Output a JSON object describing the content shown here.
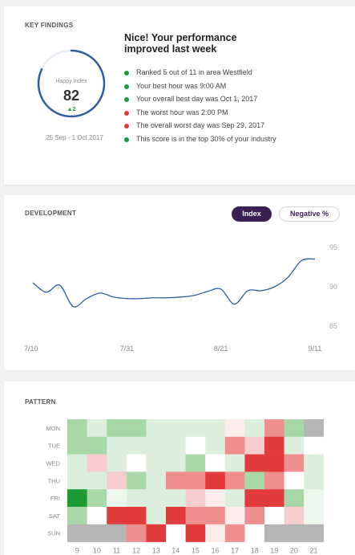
{
  "key_findings": {
    "title": "KEY FINDINGS",
    "happy_index_label": "Happy Index",
    "score": "82",
    "score_progress": 0.82,
    "delta": "▲2",
    "date_range": "25 Sep - 1 Oct 2017",
    "headline": "Nice! Your performance improved last week",
    "findings": [
      {
        "text": "Ranked 5 out of 11 in area Westfield",
        "status": "positive"
      },
      {
        "text": "Your best hour was 9:00 AM",
        "status": "positive"
      },
      {
        "text": "Your overall best day was Oct 1, 2017",
        "status": "positive"
      },
      {
        "text": "The worst hour was 2:00 PM",
        "status": "negative"
      },
      {
        "text": "The overall worst day was Sep 29, 2017",
        "status": "negative"
      },
      {
        "text": "This score is in the top 30% of your industry",
        "status": "positive"
      }
    ],
    "colors": {
      "positive": "#1a9e3a",
      "negative": "#e03a3a",
      "ring": "#2f5fa0"
    }
  },
  "development": {
    "title": "DEVELOPMENT",
    "toggle_index": "Index",
    "toggle_negative": "Negative %",
    "active_toggle": "Index"
  },
  "pattern": {
    "title": "PATTERN"
  },
  "chart_data": [
    {
      "type": "line",
      "title": "DEVELOPMENT",
      "x_tick_labels": [
        "7/10",
        "7/31",
        "8/21",
        "9/11"
      ],
      "y_ticks": [
        85,
        90,
        95
      ],
      "ylim": [
        83.5,
        96.5
      ],
      "xlim": [
        "7/10",
        "9/11"
      ],
      "grid": false,
      "line_color": "#2f5fa0",
      "series": [
        {
          "x": [
            "7/10",
            "7/13",
            "7/16",
            "7/19",
            "7/22",
            "7/25",
            "7/28",
            "7/31",
            "8/3",
            "8/6",
            "8/9",
            "8/12",
            "8/15",
            "8/18",
            "8/21",
            "8/24",
            "8/27",
            "8/30",
            "9/2",
            "9/5",
            "9/8",
            "9/11"
          ],
          "values": [
            90.5,
            89.3,
            90.2,
            87.5,
            88.5,
            89.2,
            88.7,
            88.5,
            88.5,
            88.6,
            88.6,
            88.7,
            88.9,
            89.4,
            89.7,
            87.8,
            89.5,
            89.5,
            90.0,
            91.2,
            93.3,
            93.5
          ]
        }
      ]
    },
    {
      "type": "heatmap",
      "title": "PATTERN",
      "rows": [
        "MON",
        "TUE",
        "WED",
        "THU",
        "FRI",
        "SAT",
        "SUN"
      ],
      "columns": [
        "9",
        "10",
        "11",
        "12",
        "13",
        "14",
        "15",
        "16",
        "17",
        "18",
        "19",
        "20",
        "21"
      ],
      "scale": "-3 strongly negative (red) to +3 strongly positive (green), null = no data (gray)",
      "values": [
        [
          2,
          1,
          2,
          2,
          1,
          1,
          1,
          1,
          -0.5,
          1,
          -2,
          2,
          null
        ],
        [
          2,
          2,
          1,
          1,
          1,
          1,
          0,
          1,
          -2,
          -1,
          -3,
          1,
          0
        ],
        [
          1,
          -1,
          1,
          0,
          1,
          1,
          2,
          0,
          1,
          -3,
          -3,
          -2,
          1
        ],
        [
          1,
          1,
          -1,
          2,
          1,
          -2,
          -2,
          -3,
          -2,
          2,
          -2,
          0,
          1
        ],
        [
          3,
          2,
          0.5,
          1,
          1,
          1,
          -1,
          -0.5,
          1,
          -3,
          -3,
          2,
          0.5
        ],
        [
          2,
          0,
          -3,
          -3,
          1,
          -3,
          -2,
          -2,
          -0.5,
          -2,
          0,
          -1,
          0.5
        ],
        [
          null,
          null,
          null,
          -2,
          -3,
          0,
          -3,
          -0.5,
          -2,
          0,
          null,
          null,
          null
        ]
      ]
    }
  ]
}
